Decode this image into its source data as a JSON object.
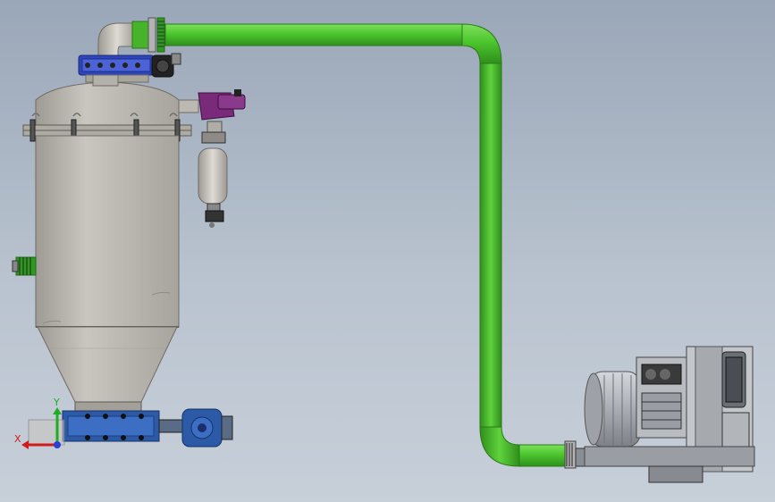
{
  "viewport": {
    "background_top": "#9aa7b8",
    "background_bottom": "#c7cfd9"
  },
  "colors": {
    "pipe_green": "#4cc62e",
    "pipe_green_dark": "#2f8f1c",
    "vessel_gray": "#b8b4ae",
    "vessel_shade": "#8f8b85",
    "flange_blue": "#2f46b8",
    "valve_purple": "#7a2a7a",
    "motor_gray": "#a9adb3",
    "feeder_blue": "#2c5aa6"
  },
  "icons": {
    "triad": "coordinate-triad-icon"
  },
  "triad": {
    "x_label": "X",
    "y_label": "Y",
    "x_color": "#d11a1a",
    "y_color": "#1fae1f",
    "z_color": "#2a3fd6"
  }
}
